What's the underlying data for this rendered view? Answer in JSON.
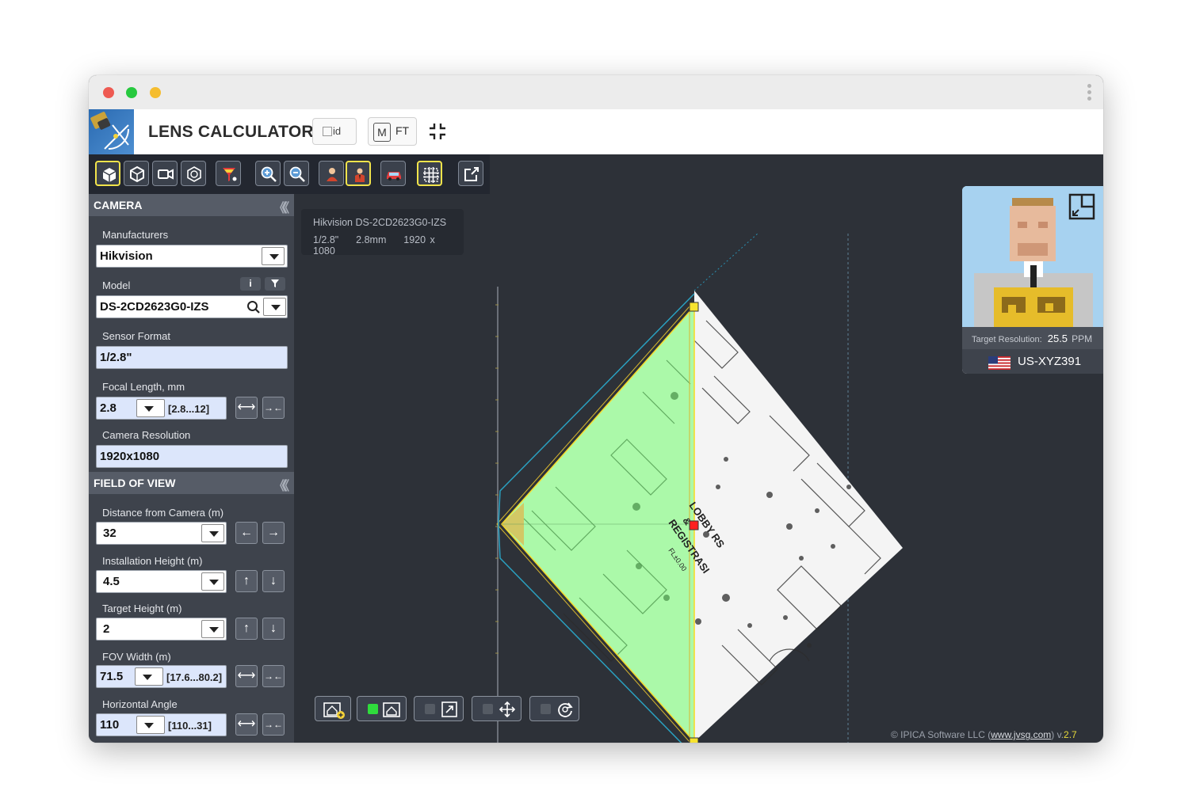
{
  "app": {
    "title": "LENS CALCULATOR",
    "id_image_alt": "id",
    "unit_m": "M",
    "unit_ft": "FT"
  },
  "camera_section": {
    "title": "CAMERA",
    "manufacturers_label": "Manufacturers",
    "manufacturer_value": "Hikvision",
    "model_label": "Model",
    "model_value": "DS-2CD2623G0-IZS",
    "model_info_btn": "i",
    "sensor_label": "Sensor Format",
    "sensor_value": "1/2.8\"",
    "focal_label": "Focal Length, mm",
    "focal_value": "2.8",
    "focal_range": "[2.8...12]",
    "resolution_label": "Camera Resolution",
    "resolution_value": "1920x1080"
  },
  "fov_section": {
    "title": "FIELD OF VIEW",
    "distance_label": "Distance from Camera (m)",
    "distance_value": "32",
    "install_height_label": "Installation Height (m)",
    "install_height_value": "4.5",
    "target_height_label": "Target Height (m)",
    "target_height_value": "2",
    "fov_width_label": "FOV Width (m)",
    "fov_width_value": "71.5",
    "fov_width_range": "[17.6...80.2]",
    "h_angle_label": "Horizontal Angle",
    "h_angle_value": "110",
    "h_angle_range": "[110...31]"
  },
  "arrows": {
    "widen": "⟷",
    "narrow": "→←",
    "left": "←",
    "right": "→",
    "up": "↑",
    "down": "↓"
  },
  "info_box": {
    "camera": "Hikvision DS-2CD2623G0-IZS",
    "sensor": "1/2.8\"",
    "focal": "2.8mm",
    "resolution": "1920 x 1080"
  },
  "map_labels": {
    "lobby": "LOBBY RS",
    "amp": "&",
    "registrasi": "REGISTRASI",
    "fl": "FL±0.00"
  },
  "ppm_card": {
    "target_label": "Target Resolution:",
    "ppm_value": "25.5",
    "ppm_unit": "PPM",
    "plate": "US-XYZ391"
  },
  "footer": {
    "copyright": "© IPICA Software LLC (",
    "link": "www.jvsg.com",
    "close": ") v.",
    "version": "2.7"
  },
  "colors": {
    "window_bg": "#2d3138",
    "sidebar_bg": "#3e434c",
    "accent_yellow": "#f2e44b",
    "fov_green": "#6dff6d",
    "marker_red": "#ff2020"
  }
}
